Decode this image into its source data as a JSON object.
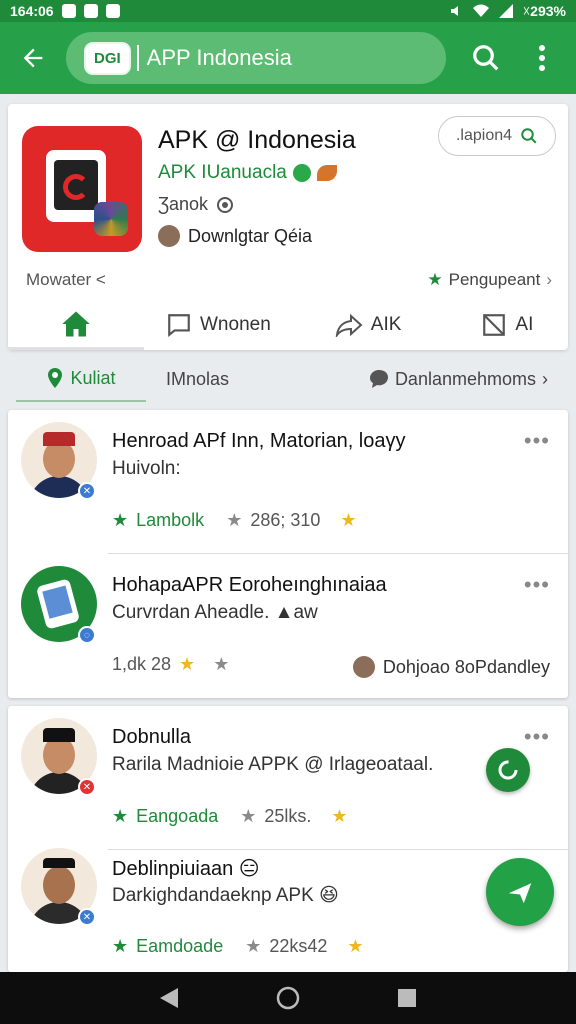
{
  "status_bar": {
    "time": "164:06",
    "battery": "☓293%"
  },
  "app_bar": {
    "badge": "DGI",
    "title": "APP Indonesia"
  },
  "hero": {
    "title": "APK @ Indonesia",
    "developer": "APK IUanuacla",
    "subtitle": "Ʒanok",
    "download": "Downlgtar Qéia",
    "action_button": ".lapion4",
    "link_left": "Mowater <",
    "link_right": "Pengupeant",
    "tabs": [
      "Wnonen",
      "AIK",
      "AI"
    ]
  },
  "filters": {
    "active": "Kuliat",
    "second": "IMnolas",
    "third": "Danlanmehmoms"
  },
  "list": [
    {
      "title": "Henroad APf Inn, Matorian, loaγy",
      "subtitle": "Huivoln:",
      "tag": "Lambolk",
      "count": "286; 310",
      "right": ""
    },
    {
      "title": "HohapaAPR Eoroheınghınaiaa",
      "subtitle": "Curvrdan Aheadle. ▲aw",
      "tag": "",
      "count": "1,dk 28",
      "right": "Dohjoao 8oPdandley"
    },
    {
      "title": "Dobnulla",
      "subtitle": "Rarila Madnioie APPK @ Irlageoataal.",
      "tag": "Eangoada",
      "count": "25lks.",
      "right": ""
    },
    {
      "title": "Deblinpiuiaan",
      "subtitle": "Darkighdandaeknp APK",
      "tag": "Eamdoade",
      "count": "22ks42",
      "right": ""
    }
  ],
  "colors": {
    "primary": "#26a049",
    "primary_dark": "#1f8a3a",
    "accent_star": "#f0b81c",
    "app_icon_red": "#e02828"
  },
  "icons": [
    "back-arrow-icon",
    "search-icon",
    "more-vert-icon",
    "home-icon",
    "chat-icon",
    "share-icon",
    "crop-icon",
    "location-icon",
    "star-icon",
    "send-icon",
    "chevron-right-icon"
  ]
}
